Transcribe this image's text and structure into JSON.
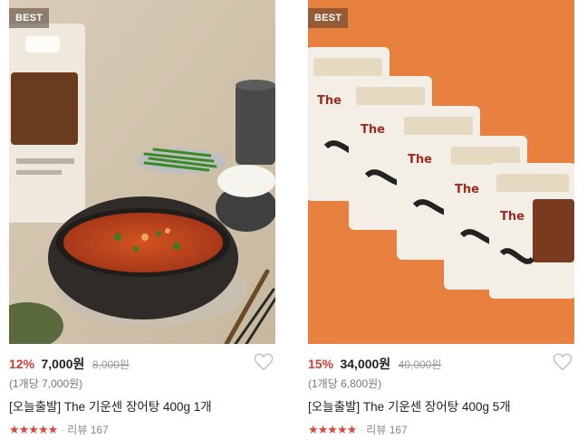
{
  "products": [
    {
      "badge": "BEST",
      "image_alt": "food-photo-eel-soup-bowl",
      "discount": "12%",
      "price": "7,000원",
      "original_price": "8,000원",
      "unit_price": "(1개당 7,000원)",
      "name": "[오늘출발] The 기운센 장어탕 400g 1개",
      "stars": "★★★★★",
      "rating_value": 4.7,
      "review_label": "리뷰 167"
    },
    {
      "badge": "BEST",
      "image_alt": "five-pouch-packages-on-orange",
      "discount": "15%",
      "price": "34,000원",
      "original_price": "40,000원",
      "unit_price": "(1개당 6,800원)",
      "name": "[오늘출발] The 기운센 장어탕 400g 5개",
      "stars": "★★★★★",
      "rating_value": 4.7,
      "review_label": "리뷰 167"
    }
  ],
  "packaging": {
    "brand_line": "The",
    "product_name": "기운센 장어탕"
  },
  "colors": {
    "discount_red": "#d63c2f",
    "star_red": "#e0473b",
    "orange_bg": "#e8813f"
  }
}
